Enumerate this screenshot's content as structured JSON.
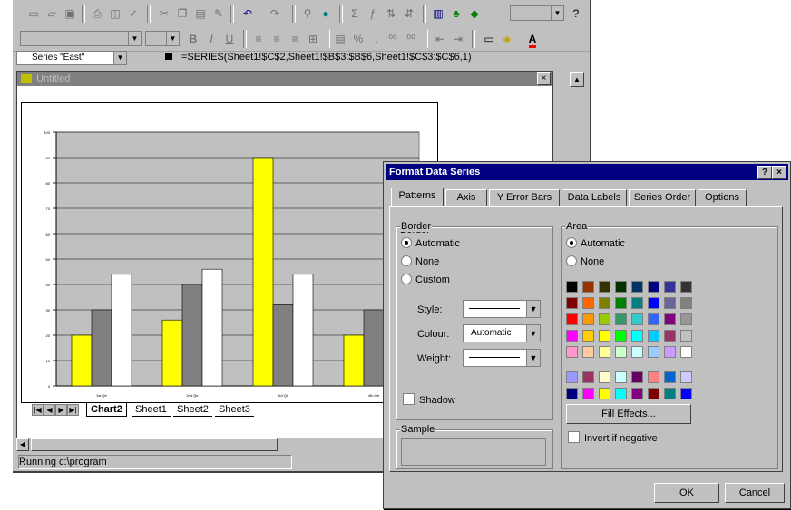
{
  "excel": {
    "series_name": "Series \"East\"",
    "formula": "=SERIES(Sheet1!$C$2,Sheet1!$B$3:$B$6,Sheet1!$C$3:$C$6,1)",
    "chart_window_title": "Untitled",
    "sheet_tabs": [
      "Chart2",
      "Sheet1",
      "Sheet2",
      "Sheet3"
    ],
    "status": "Running c:\\program"
  },
  "chart_data": {
    "type": "bar",
    "categories": [
      "1st Qtr",
      "2nd Qtr",
      "3rd Qtr",
      "4th Qtr"
    ],
    "series": [
      {
        "values": [
          20,
          26,
          90,
          20
        ],
        "color": "#ffff00"
      },
      {
        "values": [
          30,
          40,
          32,
          30
        ],
        "color": "#808080"
      },
      {
        "values": [
          44,
          46,
          44,
          46
        ],
        "color": "#ffffff"
      }
    ],
    "ylim": [
      0,
      100
    ],
    "yticks": [
      0,
      10,
      20,
      30,
      40,
      50,
      60,
      70,
      80,
      90,
      100
    ],
    "grid": true
  },
  "dialog": {
    "title": "Format Data Series",
    "help_label": "?",
    "close_label": "×",
    "tabs": [
      "Patterns",
      "Axis",
      "Y Error Bars",
      "Data Labels",
      "Series Order",
      "Options"
    ],
    "border": {
      "label": "Border",
      "automatic": "Automatic",
      "none": "None",
      "custom": "Custom",
      "style_label": "Style:",
      "colour_label": "Colour:",
      "colour_value": "Automatic",
      "weight_label": "Weight:",
      "shadow_label": "Shadow"
    },
    "area": {
      "label": "Area",
      "automatic": "Automatic",
      "none": "None",
      "fill_effects": "Fill Effects...",
      "invert": "Invert if negative"
    },
    "sample_label": "Sample",
    "ok": "OK",
    "cancel": "Cancel"
  },
  "palette": [
    [
      "#000000",
      "#993300",
      "#333300",
      "#003300",
      "#003366",
      "#000080",
      "#333399",
      "#333333"
    ],
    [
      "#800000",
      "#ff6600",
      "#808000",
      "#008000",
      "#008080",
      "#0000ff",
      "#666699",
      "#808080"
    ],
    [
      "#ff0000",
      "#ff9900",
      "#99cc00",
      "#339966",
      "#33cccc",
      "#3366ff",
      "#800080",
      "#969696"
    ],
    [
      "#ff00ff",
      "#ffcc00",
      "#ffff00",
      "#00ff00",
      "#00ffff",
      "#00ccff",
      "#993366",
      "#c0c0c0"
    ],
    [
      "#ff99cc",
      "#ffcc99",
      "#ffff99",
      "#ccffcc",
      "#ccffff",
      "#99ccff",
      "#cc99ff",
      "#ffffff"
    ],
    [
      "#9999ff",
      "#993366",
      "#ffffcc",
      "#ccffff",
      "#660066",
      "#ff8080",
      "#0066cc",
      "#ccccff"
    ],
    [
      "#000080",
      "#ff00ff",
      "#ffff00",
      "#00ffff",
      "#800080",
      "#800000",
      "#008080",
      "#0000ff"
    ]
  ]
}
